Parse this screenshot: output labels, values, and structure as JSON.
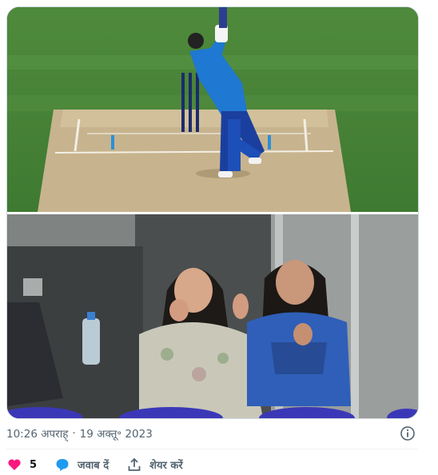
{
  "tweet": {
    "time": "10:26 अपराह्",
    "separator": "·",
    "date": "19 अक्तू॰ 2023"
  },
  "actions": {
    "like_count": "5",
    "reply_label": "जवाब दें",
    "share_label": "शेयर करें"
  },
  "colors": {
    "like": "#f91880",
    "reply": "#1d9bf0",
    "text_secondary": "#536471",
    "border": "#cfd9de"
  },
  "icons": [
    "heart-icon",
    "reply-bubble-icon",
    "share-icon",
    "info-icon"
  ],
  "media": {
    "panels": [
      "cricket-batsman-photo",
      "spectators-clapping-photo"
    ]
  }
}
